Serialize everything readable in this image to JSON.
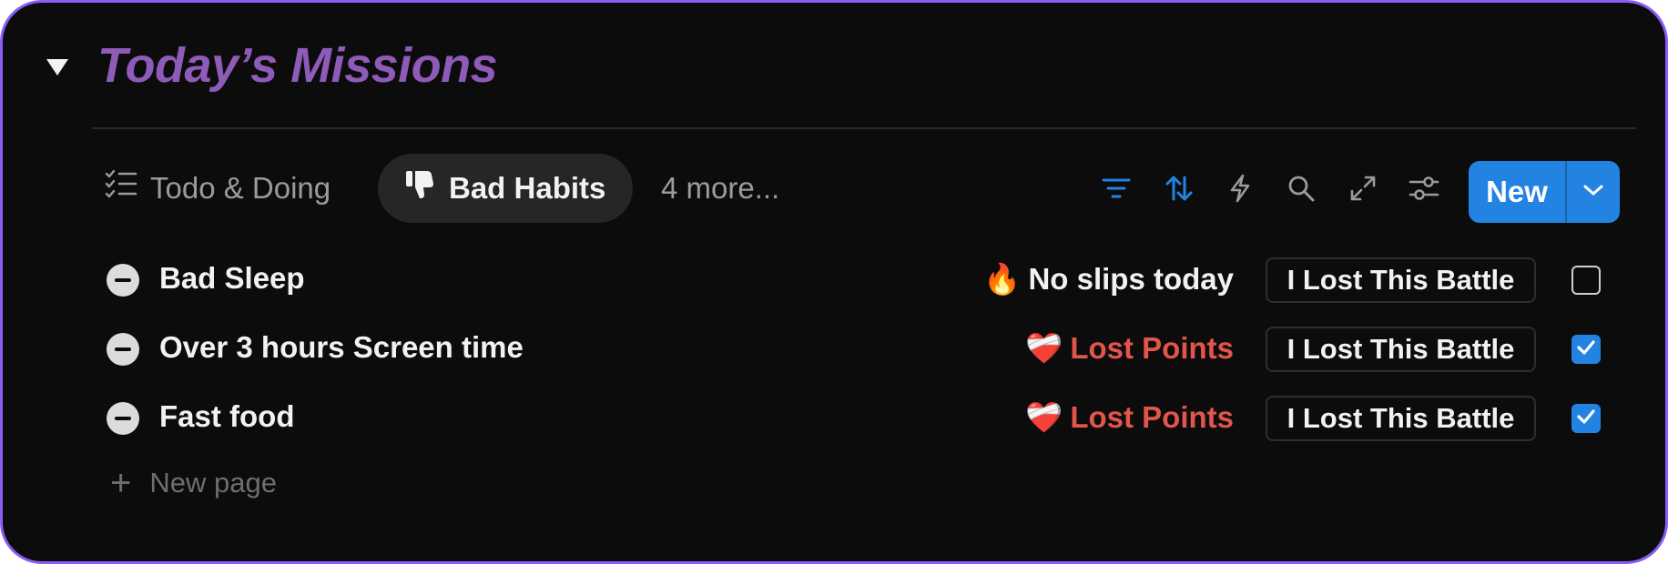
{
  "header": {
    "title": "Today’s Missions"
  },
  "tabs": [
    {
      "label": "Todo & Doing",
      "icon": "checklist-icon",
      "active": false
    },
    {
      "label": "Bad Habits",
      "icon": "thumbs-down-icon",
      "active": true
    },
    {
      "label": "4 more...",
      "active": false
    }
  ],
  "toolbar": {
    "icons": [
      "filter-icon",
      "sort-icon",
      "lightning-icon",
      "search-icon",
      "expand-icon",
      "settings-sliders-icon"
    ],
    "new_label": "New",
    "accent": "#2383e2"
  },
  "rows": [
    {
      "title": "Bad Sleep",
      "status_emoji": "🔥",
      "status": "No slips today",
      "status_color": "#f2f2f2",
      "battle": "I Lost This Battle",
      "checked": false
    },
    {
      "title": "Over 3 hours Screen time",
      "status_emoji": "❤️‍🩹",
      "status": "Lost Points",
      "status_color": "#e2554a",
      "battle": "I Lost This Battle",
      "checked": true
    },
    {
      "title": "Fast food",
      "status_emoji": "❤️‍🩹",
      "status": "Lost Points",
      "status_color": "#e2554a",
      "battle": "I Lost This Battle",
      "checked": true
    }
  ],
  "new_page": {
    "label": "New page"
  },
  "colors": {
    "title": "#8e5bb8",
    "frame_border": "#8b5cf6",
    "background": "#0c0c0d"
  }
}
